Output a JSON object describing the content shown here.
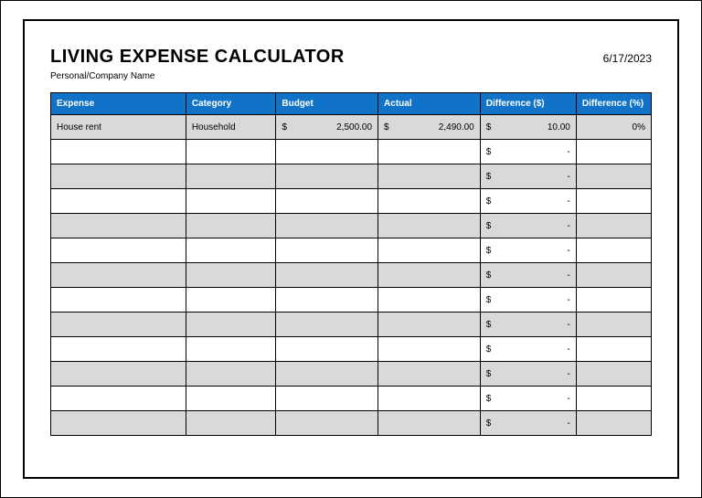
{
  "title": "LIVING EXPENSE CALCULATOR",
  "subtitle": "Personal/Company Name",
  "date": "6/17/2023",
  "columns": {
    "expense": "Expense",
    "category": "Category",
    "budget": "Budget",
    "actual": "Actual",
    "diff": "Difference ($)",
    "diffpct": "Difference (%)"
  },
  "currency_symbol": "$",
  "dash": "-",
  "rows": [
    {
      "expense": "House rent",
      "category": "Household",
      "budget": "2,500.00",
      "actual": "2,490.00",
      "diff": "10.00",
      "diffpct": "0%"
    },
    {
      "expense": "",
      "category": "",
      "budget": "",
      "actual": "",
      "diff": "-",
      "diffpct": ""
    },
    {
      "expense": "",
      "category": "",
      "budget": "",
      "actual": "",
      "diff": "-",
      "diffpct": ""
    },
    {
      "expense": "",
      "category": "",
      "budget": "",
      "actual": "",
      "diff": "-",
      "diffpct": ""
    },
    {
      "expense": "",
      "category": "",
      "budget": "",
      "actual": "",
      "diff": "-",
      "diffpct": ""
    },
    {
      "expense": "",
      "category": "",
      "budget": "",
      "actual": "",
      "diff": "-",
      "diffpct": ""
    },
    {
      "expense": "",
      "category": "",
      "budget": "",
      "actual": "",
      "diff": "-",
      "diffpct": ""
    },
    {
      "expense": "",
      "category": "",
      "budget": "",
      "actual": "",
      "diff": "-",
      "diffpct": ""
    },
    {
      "expense": "",
      "category": "",
      "budget": "",
      "actual": "",
      "diff": "-",
      "diffpct": ""
    },
    {
      "expense": "",
      "category": "",
      "budget": "",
      "actual": "",
      "diff": "-",
      "diffpct": ""
    },
    {
      "expense": "",
      "category": "",
      "budget": "",
      "actual": "",
      "diff": "-",
      "diffpct": ""
    },
    {
      "expense": "",
      "category": "",
      "budget": "",
      "actual": "",
      "diff": "-",
      "diffpct": ""
    },
    {
      "expense": "",
      "category": "",
      "budget": "",
      "actual": "",
      "diff": "-",
      "diffpct": ""
    }
  ]
}
